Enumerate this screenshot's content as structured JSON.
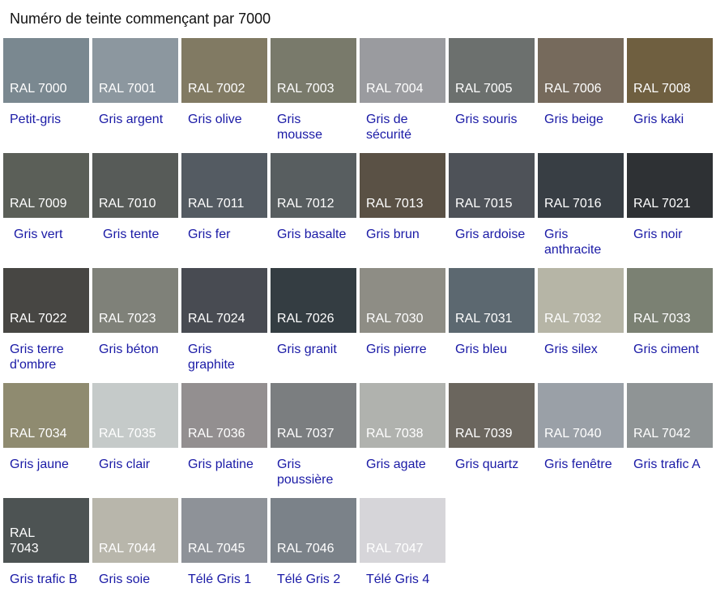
{
  "title": "Numéro de teinte commençant par 7000",
  "colors": [
    {
      "code": "RAL 7000",
      "name": "Petit-gris",
      "hex": "#7a8890"
    },
    {
      "code": "RAL 7001",
      "name": "Gris argent",
      "hex": "#8c979f"
    },
    {
      "code": "RAL 7002",
      "name": "Gris olive",
      "hex": "#817a63"
    },
    {
      "code": "RAL 7003",
      "name": "Gris mousse",
      "hex": "#797a6b"
    },
    {
      "code": "RAL 7004",
      "name": "Gris de sécurité",
      "hex": "#9a9b9f"
    },
    {
      "code": "RAL 7005",
      "name": "Gris souris",
      "hex": "#6c706e"
    },
    {
      "code": "RAL 7006",
      "name": "Gris beige",
      "hex": "#766a5c"
    },
    {
      "code": "RAL 7008",
      "name": "Gris kaki",
      "hex": "#6f5f40"
    },
    {
      "code": "RAL 7009",
      "name": "Gris vert",
      "hex": "#5b5f58"
    },
    {
      "code": "RAL 7010",
      "name": "Gris tente",
      "hex": "#575b58"
    },
    {
      "code": "RAL 7011",
      "name": "Gris fer",
      "hex": "#545b62"
    },
    {
      "code": "RAL 7012",
      "name": "Gris basalte",
      "hex": "#585e60"
    },
    {
      "code": "RAL 7013",
      "name": "Gris brun",
      "hex": "#5a5145"
    },
    {
      "code": "RAL 7015",
      "name": "Gris ardoise",
      "hex": "#4e5258"
    },
    {
      "code": "RAL 7016",
      "name": "Gris anthracite",
      "hex": "#383e44"
    },
    {
      "code": "RAL 7021",
      "name": "Gris noir",
      "hex": "#2e3134"
    },
    {
      "code": "RAL 7022",
      "name": "Gris terre d'ombre",
      "hex": "#474643"
    },
    {
      "code": "RAL 7023",
      "name": "Gris béton",
      "hex": "#7f8179"
    },
    {
      "code": "RAL 7024",
      "name": "Gris graphite",
      "hex": "#484b52"
    },
    {
      "code": "RAL 7026",
      "name": "Gris granit",
      "hex": "#343d42"
    },
    {
      "code": "RAL 7030",
      "name": "Gris pierre",
      "hex": "#8e8d85"
    },
    {
      "code": "RAL 7031",
      "name": "Gris bleu",
      "hex": "#5c6870"
    },
    {
      "code": "RAL 7032",
      "name": "Gris silex",
      "hex": "#b6b5a6"
    },
    {
      "code": "RAL 7033",
      "name": "Gris ciment",
      "hex": "#7b8173"
    },
    {
      "code": "RAL 7034",
      "name": "Gris jaune",
      "hex": "#8f8b70"
    },
    {
      "code": "RAL 7035",
      "name": "Gris clair",
      "hex": "#c5cac9"
    },
    {
      "code": "RAL 7036",
      "name": "Gris platine",
      "hex": "#938f90"
    },
    {
      "code": "RAL 7037",
      "name": "Gris poussière",
      "hex": "#7b7e80"
    },
    {
      "code": "RAL 7038",
      "name": "Gris agate",
      "hex": "#b0b2ae"
    },
    {
      "code": "RAL 7039",
      "name": "Gris quartz",
      "hex": "#6b665e"
    },
    {
      "code": "RAL 7040",
      "name": "Gris fenêtre",
      "hex": "#9aa0a7"
    },
    {
      "code": "RAL 7042",
      "name": "Gris trafic A",
      "hex": "#8f9495"
    },
    {
      "code": "RAL 7043",
      "name": "Gris trafic B",
      "hex": "#4d5353"
    },
    {
      "code": "RAL 7044",
      "name": "Gris soie",
      "hex": "#b8b6ab"
    },
    {
      "code": "RAL 7045",
      "name": "Télé Gris 1",
      "hex": "#8e9298"
    },
    {
      "code": "RAL 7046",
      "name": "Télé Gris 2",
      "hex": "#7b8289"
    },
    {
      "code": "RAL 7047",
      "name": "Télé Gris 4",
      "hex": "#d6d5d9"
    }
  ]
}
